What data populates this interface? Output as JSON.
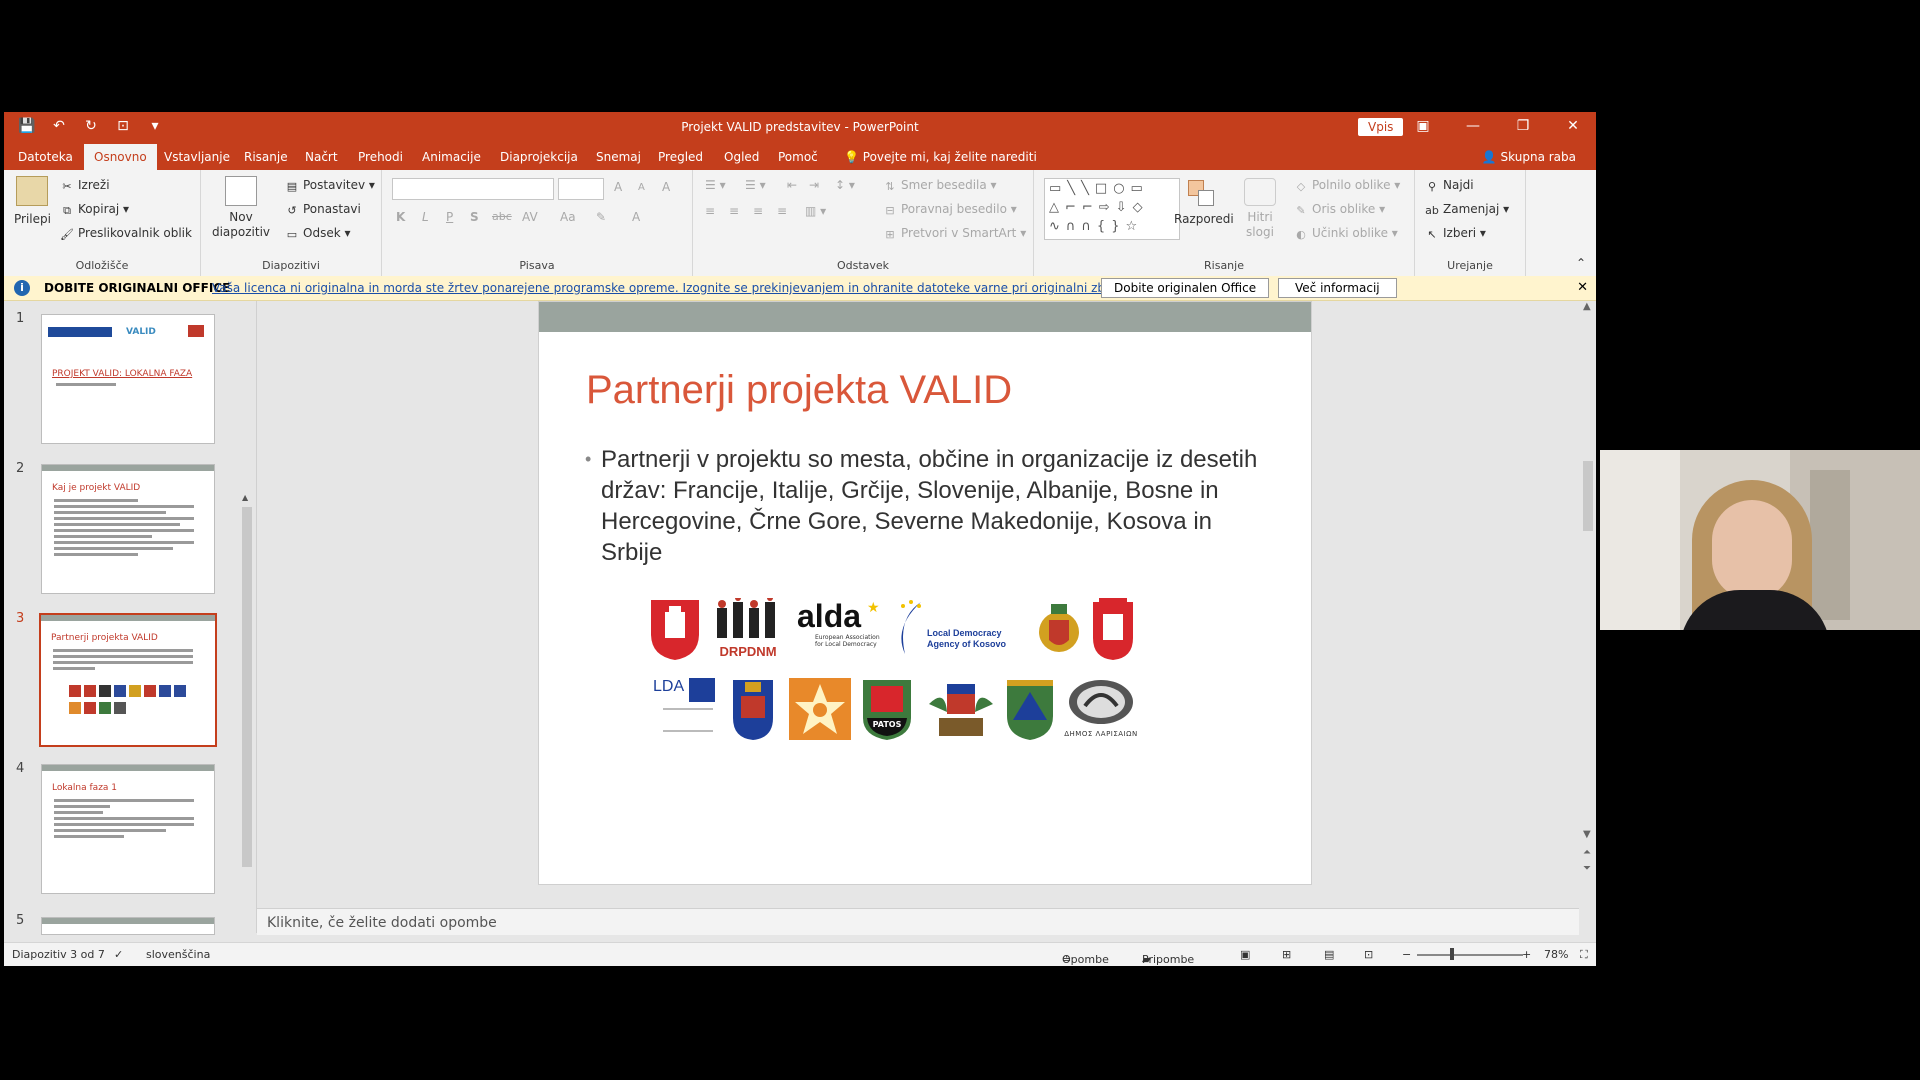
{
  "window": {
    "title": "Projekt VALID predstavitev  -  PowerPoint",
    "sign_in": "Vpis",
    "controls": {
      "minimize": "—",
      "restore": "❐",
      "close": "✕",
      "ribbon_display": "▣"
    }
  },
  "qat": {
    "save": "💾",
    "undo": "↶",
    "redo": "↻",
    "present": "⊡",
    "more": "▾"
  },
  "tabs": [
    {
      "label": "Datoteka"
    },
    {
      "label": "Osnovno",
      "active": true
    },
    {
      "label": "Vstavljanje"
    },
    {
      "label": "Risanje"
    },
    {
      "label": "Načrt"
    },
    {
      "label": "Prehodi"
    },
    {
      "label": "Animacije"
    },
    {
      "label": "Diaprojekcija"
    },
    {
      "label": "Snemaj"
    },
    {
      "label": "Pregled"
    },
    {
      "label": "Ogled"
    },
    {
      "label": "Pomoč"
    }
  ],
  "tell_me": "Povejte mi, kaj želite narediti",
  "share": "Skupna raba",
  "ribbon": {
    "clipboard": {
      "paste": "Prilepi",
      "cut": "Izreži",
      "copy": "Kopiraj",
      "format_painter": "Preslikovalnik oblik",
      "label": "Odložišče"
    },
    "slides": {
      "new_slide": "Nov diapozitiv",
      "layout": "Postavitev",
      "reset": "Ponastavi",
      "section": "Odsek",
      "label": "Diapozitivi"
    },
    "font": {
      "label": "Pisava",
      "bold": "K",
      "italic": "L",
      "underline": "P",
      "shadow": "S",
      "strike": "abc",
      "spacing": "AV",
      "case": "Aa",
      "grow": "A",
      "shrink": "A",
      "clear": "A",
      "color": "A"
    },
    "paragraph": {
      "label": "Odstavek",
      "text_direction": "Smer besedila",
      "align_text": "Poravnaj besedilo",
      "smartart": "Pretvori v SmartArt"
    },
    "drawing": {
      "label": "Risanje",
      "arrange": "Razporedi",
      "quick_styles": "Hitri slogi",
      "fill": "Polnilo oblike",
      "outline": "Oris oblike",
      "effects": "Učinki oblike"
    },
    "editing": {
      "label": "Urejanje",
      "find": "Najdi",
      "replace": "Zamenjaj",
      "select": "Izberi"
    }
  },
  "infobar": {
    "title": "DOBITE ORIGINALNI OFFICE",
    "message": "Vaša licenca ni originalna in morda ste žrtev ponarejene programske opreme. Izognite se prekinjevanjem in ohranite datoteke varne pri originalni zbirki Office.",
    "btn_get": "Dobite originalen Office",
    "btn_more": "Več informacij"
  },
  "thumbnails": [
    {
      "num": "1",
      "title": "PROJEKT VALID: LOKALNA FAZA"
    },
    {
      "num": "2",
      "title": "Kaj je projekt VALID"
    },
    {
      "num": "3",
      "title": "Partnerji projekta VALID",
      "selected": true
    },
    {
      "num": "4",
      "title": "Lokalna faza 1"
    },
    {
      "num": "5",
      "title": ""
    }
  ],
  "slide": {
    "title": "Partnerji projekta VALID",
    "body": "Partnerji v projektu so mesta, občine in organizacije iz desetih držav: Francije, Italije, Grčije, Slovenije, Albanije, Bosne in Hercegovine, Črne Gore, Severne Makedonije, Kosova in Srbije",
    "logos": {
      "drpdnm": "DRPDNM",
      "alda": "alda",
      "alda_sub": "European Association for Local Democracy",
      "ldak": "Local Democracy Agency of Kosovo",
      "lda": "LDA",
      "patos": "PATOS",
      "larisa": "ΔΗΜΟΣ ΛΑΡΙΣΑΙΩΝ"
    }
  },
  "notes_placeholder": "Kliknite, če želite dodati opombe",
  "status": {
    "slide_counter": "Diapozitiv 3 od 7",
    "language": "slovenščina",
    "notes": "Opombe",
    "comments": "Pripombe",
    "zoom": "78%"
  }
}
